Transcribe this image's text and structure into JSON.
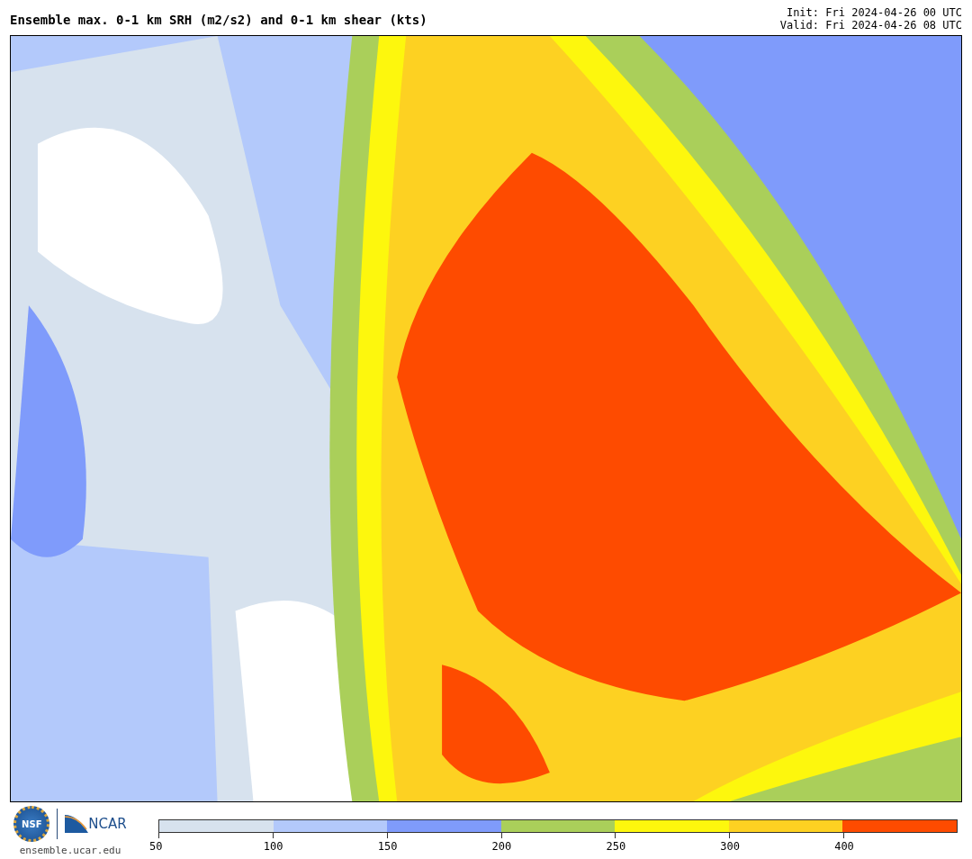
{
  "header": {
    "title": "Ensemble max. 0-1 km SRH (m2/s2) and 0-1 km shear (kts)",
    "init": "Init: Fri 2024-04-26 00 UTC",
    "valid": "Valid: Fri 2024-04-26 08 UTC"
  },
  "footer": {
    "logo_left": "NSF",
    "logo_right": "NCAR",
    "url": "ensemble.ucar.edu"
  },
  "colorbar": {
    "segments": [
      {
        "color": "#d7e2ee"
      },
      {
        "color": "#b3c9fb"
      },
      {
        "color": "#7f9bfb"
      },
      {
        "color": "#aacf5a"
      },
      {
        "color": "#fdf70d"
      },
      {
        "color": "#fdd122"
      },
      {
        "color": "#fe4b00"
      }
    ],
    "ticks": [
      "50",
      "100",
      "150",
      "200",
      "250",
      "300",
      "400"
    ]
  }
}
